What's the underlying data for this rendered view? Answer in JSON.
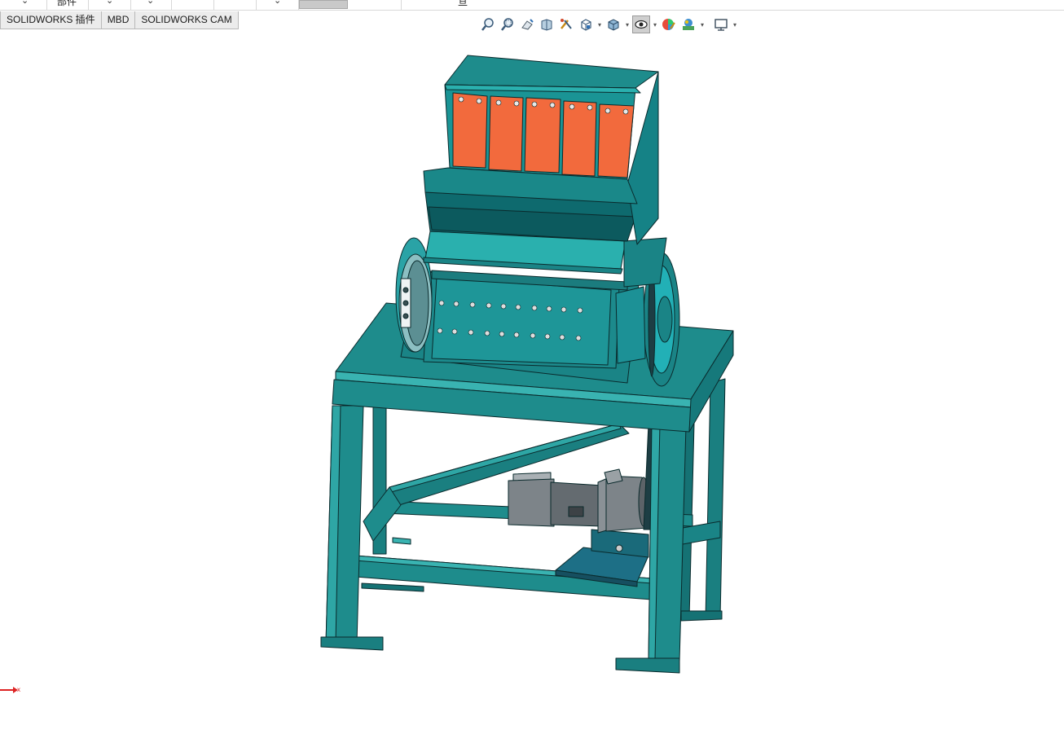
{
  "top_strip": {
    "partial_label_left": "部件",
    "partial_label_right": "亘"
  },
  "tabs": [
    {
      "label": "SOLIDWORKS 插件"
    },
    {
      "label": "MBD"
    },
    {
      "label": "SOLIDWORKS CAM"
    }
  ],
  "view_toolbar": {
    "buttons": [
      {
        "icon": "zoom-to-fit-icon"
      },
      {
        "icon": "zoom-to-area-icon"
      },
      {
        "icon": "previous-view-icon"
      },
      {
        "icon": "section-view-icon"
      },
      {
        "icon": "dynamic-annotation-views-icon"
      },
      {
        "icon": "view-orientation-icon"
      },
      {
        "icon": "display-style-icon"
      },
      {
        "icon": "hide-show-items-icon"
      },
      {
        "icon": "edit-appearance-icon"
      },
      {
        "icon": "apply-scene-icon"
      },
      {
        "icon": "view-settings-icon"
      }
    ]
  },
  "model": {
    "name": "crusher-machine",
    "colors": {
      "frame": "#1e8c8c",
      "frame_dark": "#0e5f63",
      "frame_light": "#39b3b1",
      "orange_panels": "#f26a3d",
      "motor_gray": "#7d8489",
      "edge": "#0a2a2c"
    }
  },
  "triad": {
    "axis_label": "x"
  }
}
